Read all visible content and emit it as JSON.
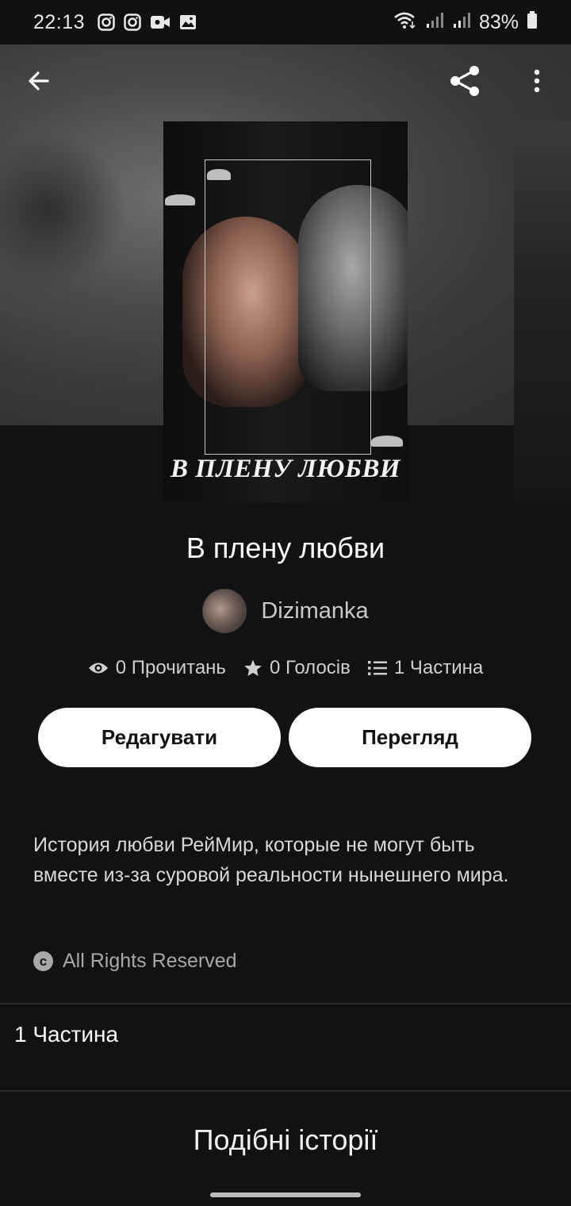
{
  "status_bar": {
    "time": "22:13",
    "battery": "83%",
    "left_icons": [
      "instagram-icon",
      "instagram-icon",
      "video-call-icon",
      "gallery-icon"
    ],
    "right_icons": [
      "wifi-icon",
      "signal-icon",
      "signal-icon",
      "battery-icon"
    ]
  },
  "toolbar": {
    "back_icon": "arrow-left-icon",
    "share_icon": "share-icon",
    "more_icon": "more-vertical-icon"
  },
  "cover": {
    "title_text": "В ПЛЕНУ ЛЮБВИ"
  },
  "story": {
    "title": "В плену любви",
    "author": "Dizimanka",
    "stats": {
      "reads": "0 Прочитань",
      "votes": "0 Голосів",
      "parts": "1 Частина"
    },
    "description": "История любви РейМир, которые не могут быть вместе из-за суровой реальности нынешнего мира.",
    "rights": "All Rights Reserved"
  },
  "actions": {
    "edit_label": "Редагувати",
    "preview_label": "Перегляд"
  },
  "parts_section": {
    "label": "1 Частина"
  },
  "similar_section": {
    "title": "Подібні історії"
  }
}
